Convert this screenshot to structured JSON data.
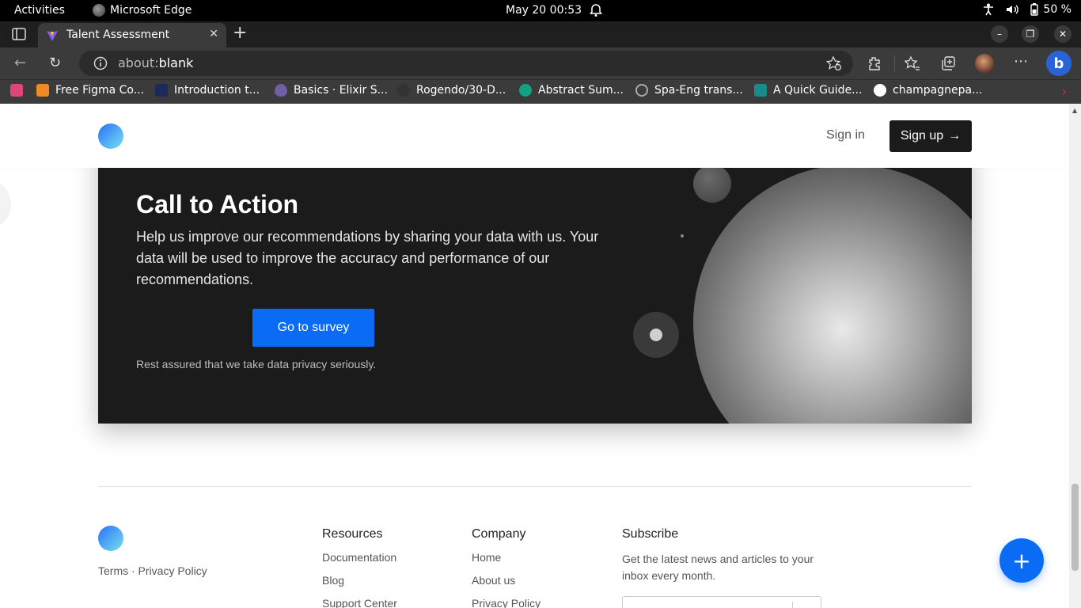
{
  "os": {
    "activities": "Activities",
    "app_name": "Microsoft Edge",
    "clock": "May 20  00:53",
    "battery": "50 %"
  },
  "browser": {
    "tab_title": "Talent Assessment",
    "new_tab": "+",
    "url_prefix": "about:",
    "url_rest": "blank",
    "bookmarks": [
      {
        "label": "Free Figma Co...",
        "color": "#e0457a"
      },
      {
        "label": "Introduction t...",
        "color": "#1a2a5a"
      },
      {
        "label": "Basics · Elixir S...",
        "color": "#6f5ea8"
      },
      {
        "label": "Rogendo/30-D...",
        "color": "#333333"
      },
      {
        "label": "Abstract Sum...",
        "color": "#10a37f"
      },
      {
        "label": "Spa-Eng trans...",
        "color": "#aaaaaa"
      },
      {
        "label": "A Quick Guide...",
        "color": "#1a8a8a"
      },
      {
        "label": "champagnepa...",
        "color": "#ffffff"
      }
    ]
  },
  "header": {
    "sign_in": "Sign in",
    "sign_up": "Sign up",
    "sign_up_arrow": "→"
  },
  "cta": {
    "title": "Call to Action",
    "description": "Help us improve our recommendations by sharing your data with us. Your data will be used to improve the accuracy and performance of our recommendations.",
    "button": "Go to survey",
    "note": "Rest assured that we take data privacy seriously."
  },
  "footer": {
    "legal": "Terms · Privacy Policy",
    "resources": {
      "title": "Resources",
      "links": [
        "Documentation",
        "Blog",
        "Support Center"
      ]
    },
    "company": {
      "title": "Company",
      "links": [
        "Home",
        "About us",
        "Privacy Policy"
      ]
    },
    "subscribe": {
      "title": "Subscribe",
      "text": "Get the latest news and articles to your inbox every month."
    }
  },
  "fab": "+",
  "colors": {
    "accent": "#0a6cf5",
    "cta_bg": "#1b1b1b"
  }
}
